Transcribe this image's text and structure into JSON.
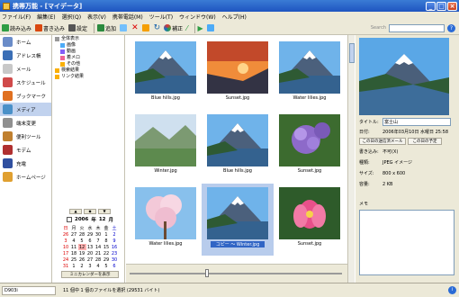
{
  "window": {
    "title": "携帯万能 - [マイデータ]"
  },
  "menubar": [
    "ファイル(F)",
    "編集(E)",
    "選択(Q)",
    "表示(V)",
    "携帯電話(M)",
    "ツール(T)",
    "ウィンドウ(W)",
    "ヘルプ(H)"
  ],
  "toolbar": {
    "read": "読み込み",
    "write": "書き込み",
    "settings": "設定",
    "add": "追加",
    "edit": "補正",
    "search_label": "Search"
  },
  "sidebar": [
    {
      "label": "ホーム",
      "icon": "home-icon",
      "color": "#6a8cc8"
    },
    {
      "label": "アドレス帳",
      "icon": "address-book-icon",
      "color": "#3b6fb6"
    },
    {
      "label": "メール",
      "icon": "mail-icon",
      "color": "#c8c8c8"
    },
    {
      "label": "スケジュール",
      "icon": "schedule-icon",
      "color": "#d04a4a"
    },
    {
      "label": "ブックマーク",
      "icon": "bookmark-icon",
      "color": "#e07020"
    },
    {
      "label": "メディア",
      "icon": "media-icon",
      "color": "#4a90c8"
    },
    {
      "label": "端末変更",
      "icon": "device-change-icon",
      "color": "#909090"
    },
    {
      "label": "便利ツール",
      "icon": "tools-icon",
      "color": "#c08030"
    },
    {
      "label": "モデム",
      "icon": "modem-icon",
      "color": "#b03030"
    },
    {
      "label": "充電",
      "icon": "charge-icon",
      "color": "#3050a0"
    },
    {
      "label": "ホームページ",
      "icon": "homepage-icon",
      "color": "#e0a030"
    }
  ],
  "tree": [
    "全体表示",
    "画像",
    "動画",
    "着メロ",
    "その他",
    "検索結果",
    "リンク結果"
  ],
  "calendar": {
    "year": "2006",
    "month": "12",
    "year_unit": "年",
    "month_unit": "月",
    "weekdays": [
      "日",
      "月",
      "火",
      "水",
      "木",
      "金",
      "土"
    ],
    "weeks": [
      [
        "26",
        "27",
        "28",
        "29",
        "30",
        "1",
        "2"
      ],
      [
        "3",
        "4",
        "5",
        "6",
        "7",
        "8",
        "9"
      ],
      [
        "10",
        "11",
        "12",
        "13",
        "14",
        "15",
        "16"
      ],
      [
        "17",
        "18",
        "19",
        "20",
        "21",
        "22",
        "23"
      ],
      [
        "24",
        "25",
        "26",
        "27",
        "28",
        "29",
        "30"
      ],
      [
        "31",
        "1",
        "2",
        "3",
        "4",
        "5",
        "6"
      ]
    ],
    "today": "12",
    "mini_button": "ミニカレンダーを表示"
  },
  "gallery": [
    {
      "caption": "Blue hills.jpg",
      "scene": "mountain-icon"
    },
    {
      "caption": "Sunset.jpg",
      "scene": "sunset-icon"
    },
    {
      "caption": "Water lilies.jpg",
      "scene": "mountain-icon"
    },
    {
      "caption": "Winter.jpg",
      "scene": "hills-icon"
    },
    {
      "caption": "Blue hills.jpg",
      "scene": "mountain-icon"
    },
    {
      "caption": "Sunset.jpg",
      "scene": "flower-icon"
    },
    {
      "caption": "Water lilies.jpg",
      "scene": "cherry-icon"
    },
    {
      "caption": "コピー ～ Winter.jpg",
      "scene": "mountain-icon",
      "selected": true
    },
    {
      "caption": "Sunset.jpg",
      "scene": "lotus-icon"
    }
  ],
  "details": {
    "title_label": "タイトル:",
    "title_value": "富士山",
    "date_label": "日付:",
    "date_value": "2006年03月10日 水曜日 25:58",
    "btn_mail": "この日の送信済メール",
    "btn_schedule": "この日の予定",
    "write_label": "書き込み:",
    "write_value": "不可(X)",
    "type_label": "種類:",
    "type_value": "JPEG イメージ",
    "size_label": "サイズ:",
    "size_value": "800 x 600",
    "volume_label": "容量:",
    "volume_value": "2 KB",
    "memo_label": "メモ"
  },
  "status": {
    "left": "D903i",
    "text": "11 個中 1 個のファイルを選択 (29531 バイト)"
  }
}
